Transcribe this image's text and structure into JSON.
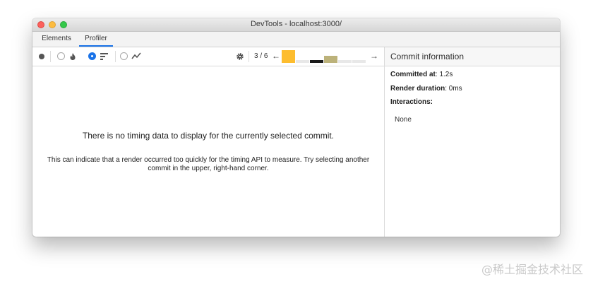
{
  "window": {
    "title": "DevTools - localhost:3000/"
  },
  "tabs": [
    {
      "label": "Elements",
      "active": false
    },
    {
      "label": "Profiler",
      "active": true
    }
  ],
  "toolbar": {
    "commit_index": "3 / 6",
    "prev_arrow": "←",
    "next_arrow": "→",
    "record_icon": "record-icon",
    "reload_icon": "reload-icon",
    "flame_icon": "flame-chart-icon",
    "ranked_icon": "ranked-chart-icon",
    "interactions_icon": "interactions-icon",
    "settings_icon": "gear-icon",
    "commits": [
      {
        "duration": 1.0,
        "color": "#fdbd2f",
        "selected": true
      },
      {
        "duration": 0.22,
        "color": "#e8e8e8",
        "selected": false
      },
      {
        "duration": 0.22,
        "color": "#1a1a1a",
        "selected": false
      },
      {
        "duration": 0.55,
        "color": "#bcb27a",
        "selected": false
      },
      {
        "duration": 0.22,
        "color": "#e8e8e8",
        "selected": false
      },
      {
        "duration": 0.22,
        "color": "#e8e8e8",
        "selected": false
      }
    ]
  },
  "main": {
    "empty_title": "There is no timing data to display for the currently selected commit.",
    "empty_hint_line1": "This can indicate that a render occurred too quickly for the timing API to measure. Try selecting another",
    "empty_hint_line2": "commit in the upper, right-hand corner."
  },
  "commit_info": {
    "header": "Commit information",
    "committed_at_label": "Committed at",
    "committed_at_value": ": 1.2s",
    "render_duration_label": "Render duration",
    "render_duration_value": ": 0ms",
    "interactions_label": "Interactions:",
    "interactions_value": "None"
  },
  "watermark": "@稀土掘金技术社区",
  "colors": {
    "accent": "#1a73e8",
    "selected_commit": "#fdbd2f"
  }
}
